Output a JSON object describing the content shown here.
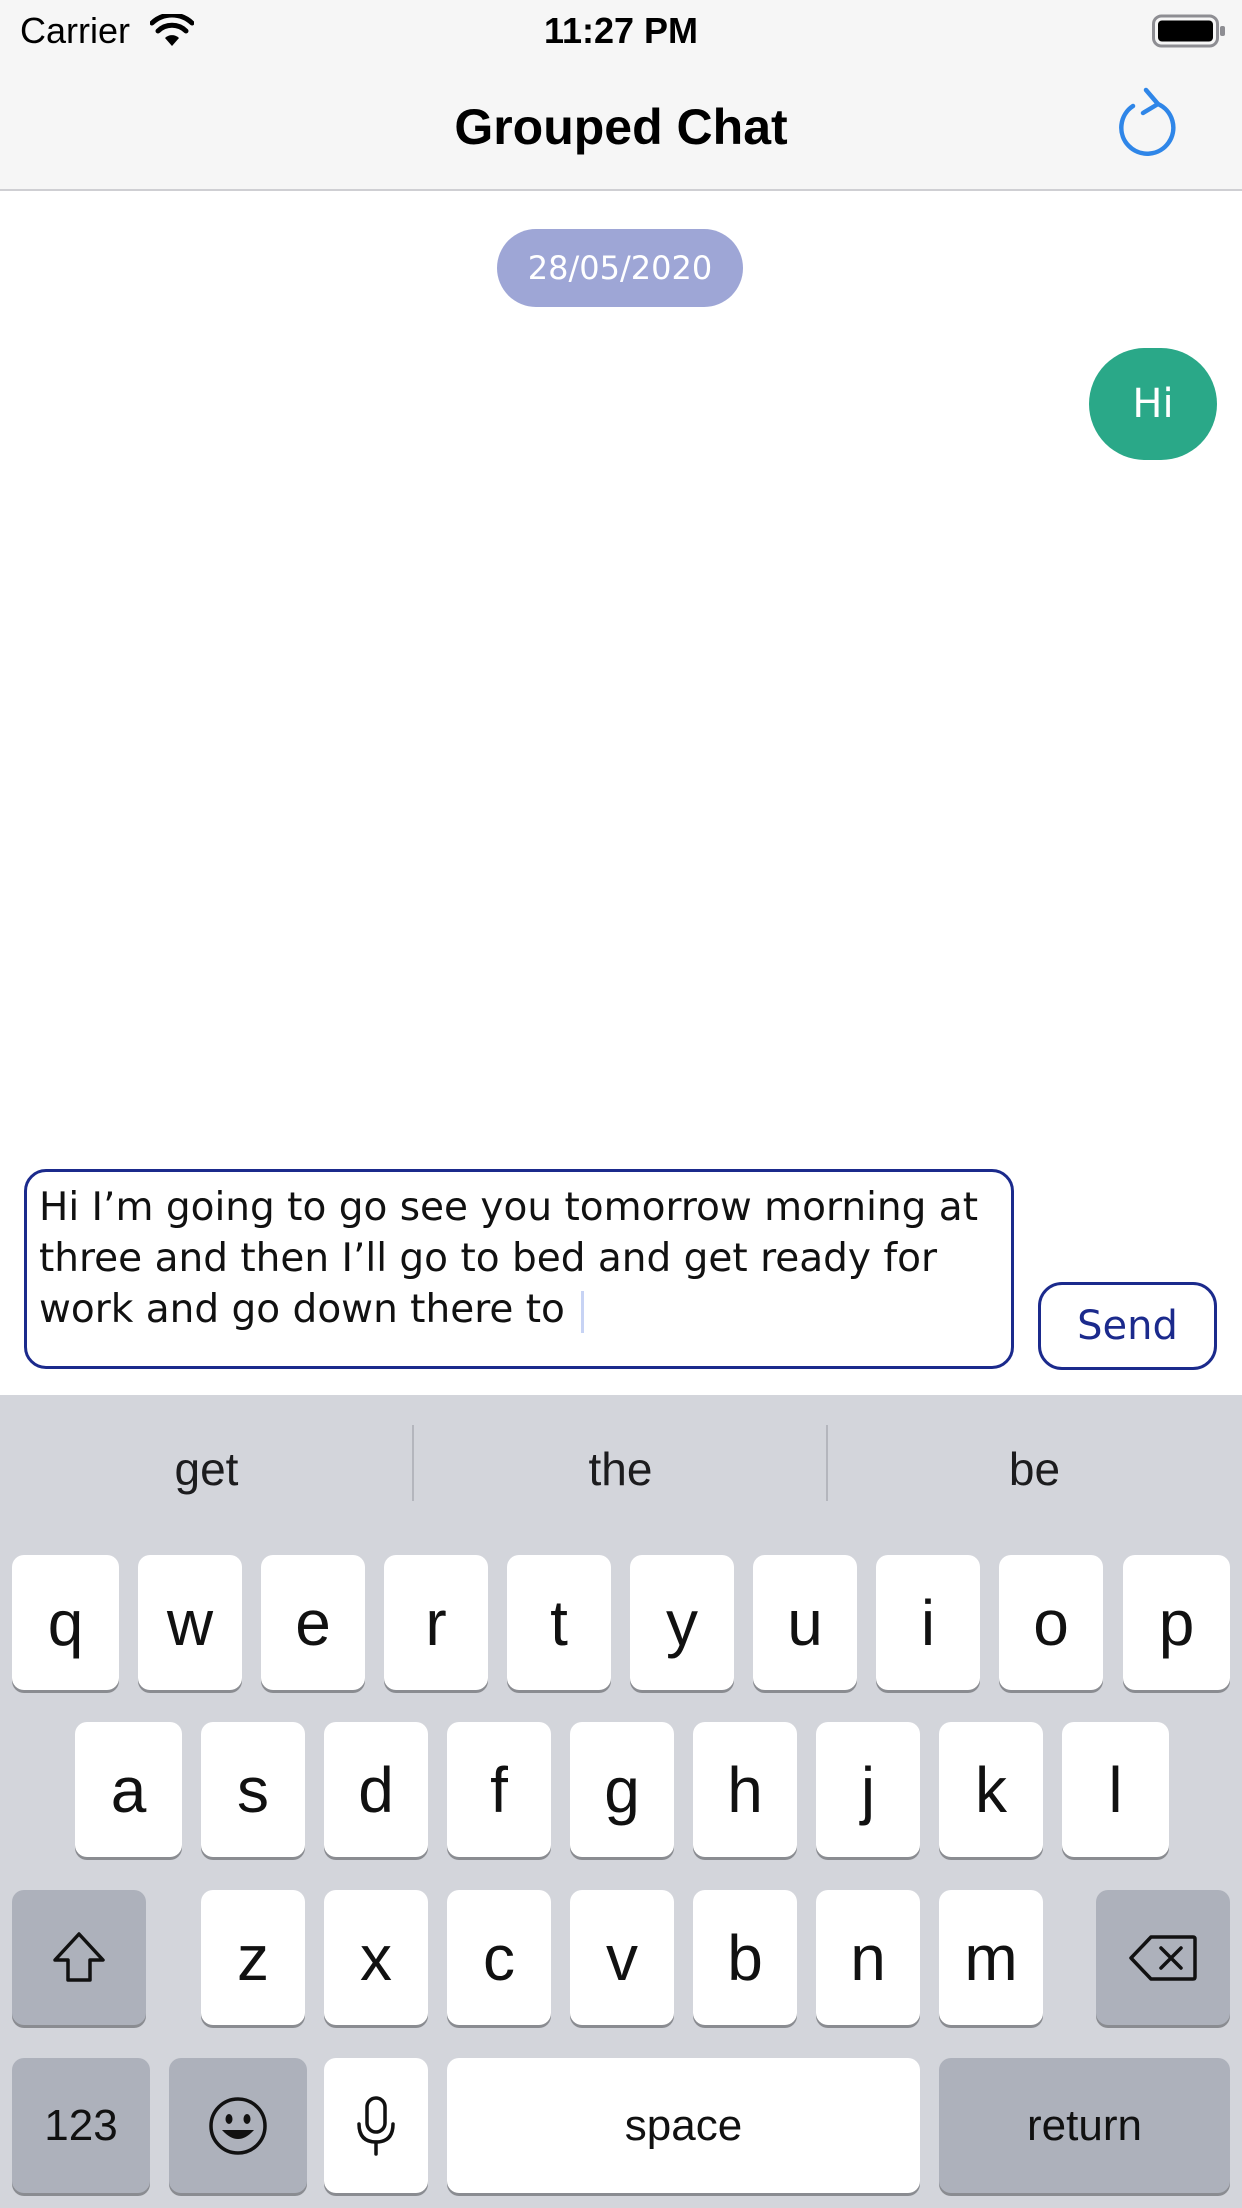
{
  "status_bar": {
    "carrier": "Carrier",
    "time": "11:27 PM"
  },
  "nav": {
    "title": "Grouped Chat",
    "refresh_icon": "refresh-icon"
  },
  "chat": {
    "date_separator": "28/05/2020",
    "messages": [
      {
        "direction": "outgoing",
        "text": "Hi"
      }
    ]
  },
  "composer": {
    "input_value": "Hi I’m going to go see you tomorrow morning at three and then I’ll go to bed and get ready for work and go down there to ",
    "send_label": "Send"
  },
  "keyboard": {
    "suggestions": [
      "get",
      "the",
      "be"
    ],
    "row1": [
      "q",
      "w",
      "e",
      "r",
      "t",
      "y",
      "u",
      "i",
      "o",
      "p"
    ],
    "row2": [
      "a",
      "s",
      "d",
      "f",
      "g",
      "h",
      "j",
      "k",
      "l"
    ],
    "row3": [
      "z",
      "x",
      "c",
      "v",
      "b",
      "n",
      "m"
    ],
    "numbers_label": "123",
    "space_label": "space",
    "return_label": "return"
  },
  "colors": {
    "accent_blue": "#1b2a8c",
    "bubble_green": "#2aa888",
    "date_pill": "#9ea6d6",
    "refresh_blue": "#2f86e8"
  }
}
